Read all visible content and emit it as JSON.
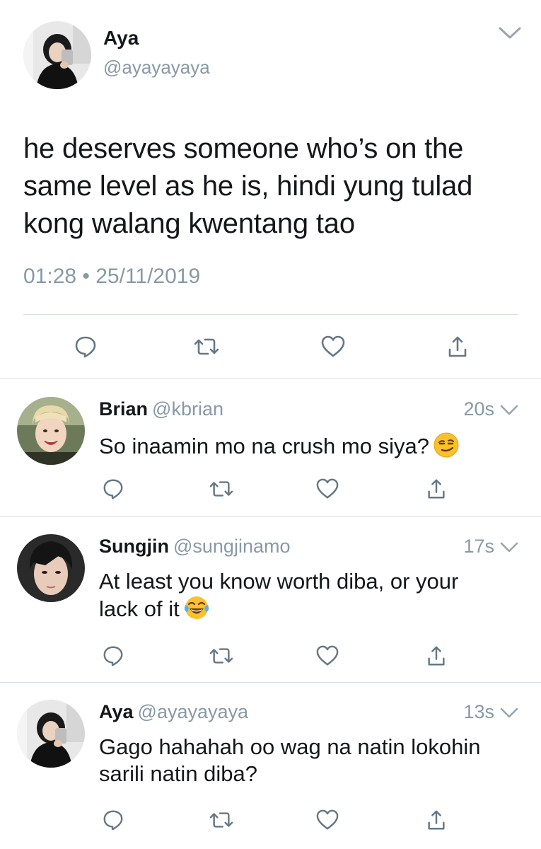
{
  "main_tweet": {
    "name": "Aya",
    "handle": "@ayayayaya",
    "text": "he deserves someone who’s on the same level as he is, hindi yung tulad kong walang kwentang tao",
    "timestamp": "01:28 • 25/11/2019"
  },
  "replies": [
    {
      "name": "Brian",
      "handle": "@kbrian",
      "time": "20s",
      "text": "So inaamin mo na crush mo siya?",
      "emoji": "smirking-face"
    },
    {
      "name": "Sungjin",
      "handle": "@sungjinamo",
      "time": "17s",
      "text": "At least you know worth diba, or your lack of it",
      "emoji": "face-with-tears-of-joy"
    },
    {
      "name": "Aya",
      "handle": "@ayayayaya",
      "time": "13s",
      "text": "Gago hahahah oo wag na natin lokohin sarili natin diba?",
      "emoji": ""
    }
  ],
  "icons": [
    "reply-icon",
    "retweet-icon",
    "like-icon",
    "share-icon",
    "chevron-down-icon"
  ],
  "colors": {
    "text": "#14171a",
    "secondary": "#8899a6",
    "icon": "#657786",
    "divider": "#d8dee4"
  }
}
